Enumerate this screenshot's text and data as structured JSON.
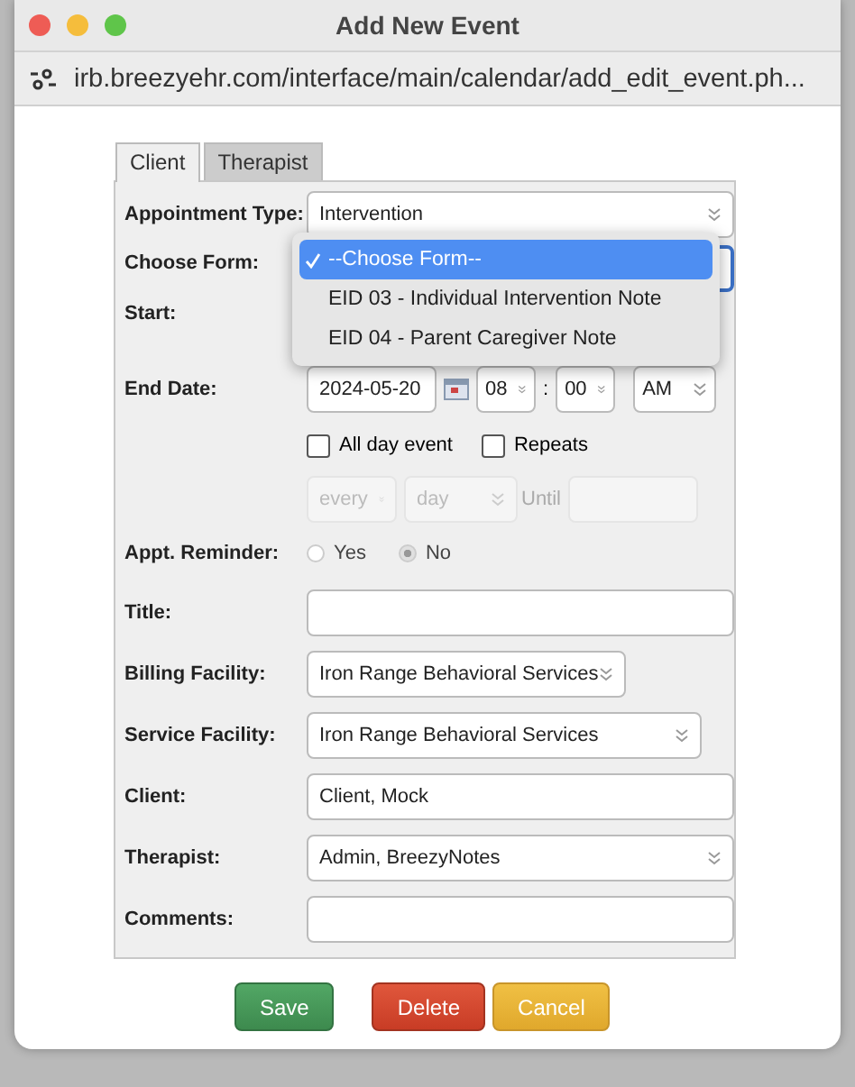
{
  "window": {
    "title": "Add New Event"
  },
  "address_bar": {
    "url": "irb.breezyehr.com/interface/main/calendar/add_edit_event.ph..."
  },
  "tabs": [
    {
      "label": "Client",
      "selected": true
    },
    {
      "label": "Therapist",
      "selected": false
    }
  ],
  "form": {
    "fields": [
      {
        "kind": "select",
        "label": "Appointment Type:",
        "value": "Intervention"
      },
      {
        "kind": "select_open",
        "label": "Choose Form:",
        "options": [
          {
            "label": "--Choose Form--",
            "selected": true
          },
          {
            "label": "EID 03 - Individual Intervention Note",
            "selected": false
          },
          {
            "label": "EID 04 - Parent Caregiver Note",
            "selected": false
          }
        ]
      },
      {
        "kind": "blank",
        "label": "Start:"
      },
      {
        "kind": "datetime",
        "label": "End Date:",
        "date": "2024-05-20",
        "hour": "08",
        "separator": ":",
        "minute": "00",
        "ampm": "AM"
      },
      {
        "kind": "checks",
        "items": [
          {
            "label": "All day event",
            "checked": false
          },
          {
            "label": "Repeats",
            "checked": false
          }
        ]
      },
      {
        "kind": "repeat",
        "disabled": true,
        "every": "every",
        "unit": "day",
        "until_label": "Until"
      },
      {
        "kind": "radio",
        "label": "Appt. Reminder:",
        "disabled": true,
        "options": [
          {
            "label": "Yes",
            "selected": false
          },
          {
            "label": "No",
            "selected": true
          }
        ]
      },
      {
        "kind": "text",
        "label": "Title:"
      },
      {
        "kind": "select",
        "label": "Billing Facility:",
        "value": "Iron Range Behavioral Services"
      },
      {
        "kind": "select",
        "label": "Service Facility:",
        "value": "Iron Range Behavioral Services"
      },
      {
        "kind": "text",
        "label": "Client:",
        "value": "Client, Mock"
      },
      {
        "kind": "select",
        "label": "Therapist:",
        "value": "Admin, BreezyNotes"
      },
      {
        "kind": "text",
        "label": "Comments:"
      }
    ]
  },
  "buttons": [
    {
      "label": "Save",
      "kind": "save"
    },
    {
      "label": "Delete",
      "kind": "delete"
    },
    {
      "label": "Cancel",
      "kind": "cancel"
    }
  ]
}
